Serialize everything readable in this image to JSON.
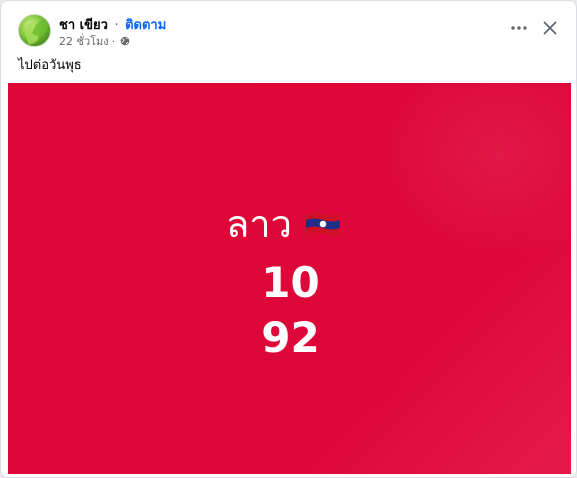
{
  "post": {
    "author": "ชา เขียว",
    "separator": "·",
    "follow_label": "ติดตาม",
    "time": "22 ชั่วโมง",
    "time_separator": "·",
    "caption": "ไปต่อวันพุธ"
  },
  "image": {
    "country_label": "ลาว",
    "number_1": "10",
    "number_2": "92",
    "background_color": "#dd0738",
    "flag": "laos-flag-icon"
  },
  "actions": {
    "more_icon": "more-horizontal-icon",
    "close_icon": "close-icon"
  }
}
